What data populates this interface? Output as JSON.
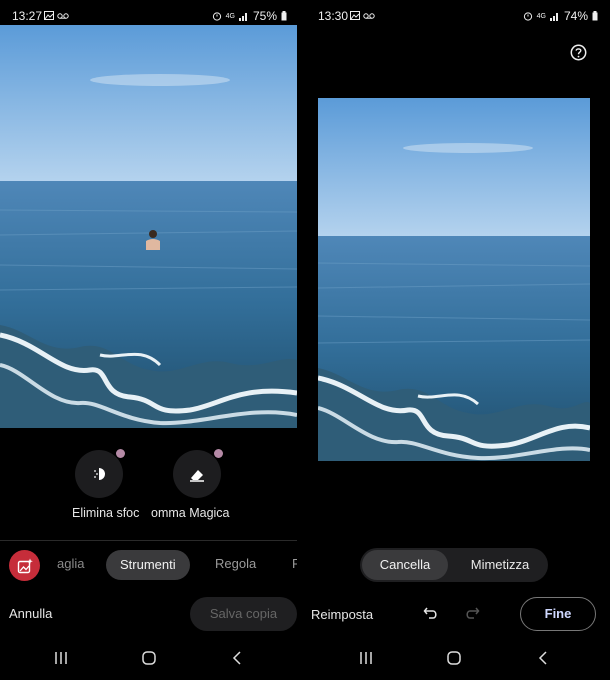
{
  "left": {
    "status": {
      "time": "13:27",
      "battery": "75%",
      "network": "4G"
    },
    "tools": [
      {
        "label": "Elimina sfoc",
        "icon": "blur-icon"
      },
      {
        "label": "omma Magica",
        "icon": "eraser-icon"
      }
    ],
    "tabs": {
      "prev": "aglia",
      "active": "Strumenti",
      "next": "Regola",
      "cut": "F"
    },
    "cancel_label": "Annulla",
    "save_copy_label": "Salva copia",
    "colors": {
      "accent_badge": "#b58aa6",
      "app_icon_bg": "#c62d3a"
    }
  },
  "right": {
    "status": {
      "time": "13:30",
      "battery": "74%",
      "network": "4G"
    },
    "segment": {
      "selected": "Cancella",
      "other": "Mimetizza"
    },
    "reset_label": "Reimposta",
    "done_label": "Fine"
  },
  "navbar": {
    "icons": [
      "recents-icon",
      "home-icon",
      "back-icon"
    ]
  }
}
